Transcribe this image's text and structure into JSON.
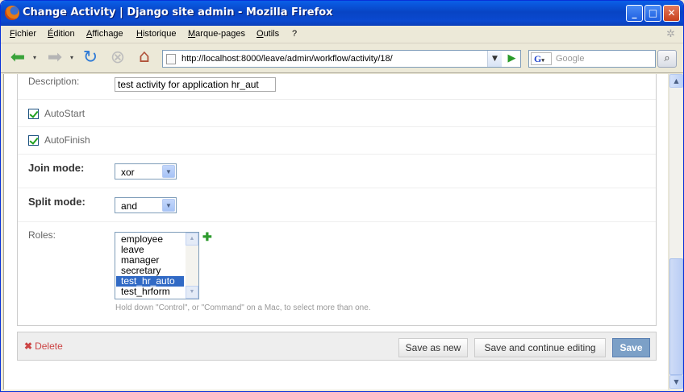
{
  "window": {
    "title": "Change Activity | Django site admin - Mozilla Firefox",
    "controls": {
      "minimize": "_",
      "maximize": "□",
      "close": "✕"
    }
  },
  "menu": {
    "items": [
      "Fichier",
      "Édition",
      "Affichage",
      "Historique",
      "Marque-pages",
      "Outils",
      "?"
    ]
  },
  "nav": {
    "url": "http://localhost:8000/leave/admin/workflow/activity/18/",
    "search_placeholder": "Google",
    "icons": [
      "back-icon",
      "forward-icon",
      "reload-icon",
      "stop-icon",
      "home-icon"
    ]
  },
  "form": {
    "description_label": "Description:",
    "description_value": "test activity for application hr_aut",
    "autostart_label": "AutoStart",
    "autostart_checked": true,
    "autofinish_label": "AutoFinish",
    "autofinish_checked": true,
    "join_label": "Join mode:",
    "join_value": "xor",
    "split_label": "Split mode:",
    "split_value": "and",
    "roles_label": "Roles:",
    "roles_options": [
      "employee",
      "leave",
      "manager",
      "secretary",
      "test_hr_auto",
      "test_hrform"
    ],
    "roles_selected": "test_hr_auto",
    "roles_help": "Hold down \"Control\", or \"Command\" on a Mac, to select more than one."
  },
  "actions": {
    "delete_label": "Delete",
    "save_as_new_label": "Save as new",
    "save_continue_label": "Save and continue editing",
    "save_label": "Save"
  },
  "colors": {
    "titlebar": "#0a5fe8",
    "selected_option": "#316ac5",
    "save_button": "#7ca0c7",
    "delete_link": "#cc4444"
  }
}
